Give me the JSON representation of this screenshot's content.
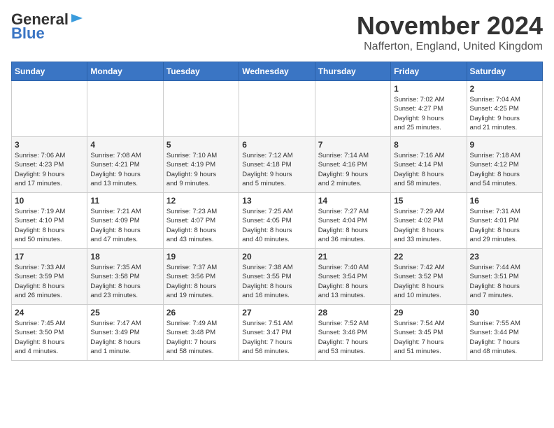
{
  "logo": {
    "line1": "General",
    "line2": "Blue"
  },
  "header": {
    "month": "November 2024",
    "location": "Nafferton, England, United Kingdom"
  },
  "days_of_week": [
    "Sunday",
    "Monday",
    "Tuesday",
    "Wednesday",
    "Thursday",
    "Friday",
    "Saturday"
  ],
  "weeks": [
    [
      {
        "day": "",
        "info": ""
      },
      {
        "day": "",
        "info": ""
      },
      {
        "day": "",
        "info": ""
      },
      {
        "day": "",
        "info": ""
      },
      {
        "day": "",
        "info": ""
      },
      {
        "day": "1",
        "info": "Sunrise: 7:02 AM\nSunset: 4:27 PM\nDaylight: 9 hours\nand 25 minutes."
      },
      {
        "day": "2",
        "info": "Sunrise: 7:04 AM\nSunset: 4:25 PM\nDaylight: 9 hours\nand 21 minutes."
      }
    ],
    [
      {
        "day": "3",
        "info": "Sunrise: 7:06 AM\nSunset: 4:23 PM\nDaylight: 9 hours\nand 17 minutes."
      },
      {
        "day": "4",
        "info": "Sunrise: 7:08 AM\nSunset: 4:21 PM\nDaylight: 9 hours\nand 13 minutes."
      },
      {
        "day": "5",
        "info": "Sunrise: 7:10 AM\nSunset: 4:19 PM\nDaylight: 9 hours\nand 9 minutes."
      },
      {
        "day": "6",
        "info": "Sunrise: 7:12 AM\nSunset: 4:18 PM\nDaylight: 9 hours\nand 5 minutes."
      },
      {
        "day": "7",
        "info": "Sunrise: 7:14 AM\nSunset: 4:16 PM\nDaylight: 9 hours\nand 2 minutes."
      },
      {
        "day": "8",
        "info": "Sunrise: 7:16 AM\nSunset: 4:14 PM\nDaylight: 8 hours\nand 58 minutes."
      },
      {
        "day": "9",
        "info": "Sunrise: 7:18 AM\nSunset: 4:12 PM\nDaylight: 8 hours\nand 54 minutes."
      }
    ],
    [
      {
        "day": "10",
        "info": "Sunrise: 7:19 AM\nSunset: 4:10 PM\nDaylight: 8 hours\nand 50 minutes."
      },
      {
        "day": "11",
        "info": "Sunrise: 7:21 AM\nSunset: 4:09 PM\nDaylight: 8 hours\nand 47 minutes."
      },
      {
        "day": "12",
        "info": "Sunrise: 7:23 AM\nSunset: 4:07 PM\nDaylight: 8 hours\nand 43 minutes."
      },
      {
        "day": "13",
        "info": "Sunrise: 7:25 AM\nSunset: 4:05 PM\nDaylight: 8 hours\nand 40 minutes."
      },
      {
        "day": "14",
        "info": "Sunrise: 7:27 AM\nSunset: 4:04 PM\nDaylight: 8 hours\nand 36 minutes."
      },
      {
        "day": "15",
        "info": "Sunrise: 7:29 AM\nSunset: 4:02 PM\nDaylight: 8 hours\nand 33 minutes."
      },
      {
        "day": "16",
        "info": "Sunrise: 7:31 AM\nSunset: 4:01 PM\nDaylight: 8 hours\nand 29 minutes."
      }
    ],
    [
      {
        "day": "17",
        "info": "Sunrise: 7:33 AM\nSunset: 3:59 PM\nDaylight: 8 hours\nand 26 minutes."
      },
      {
        "day": "18",
        "info": "Sunrise: 7:35 AM\nSunset: 3:58 PM\nDaylight: 8 hours\nand 23 minutes."
      },
      {
        "day": "19",
        "info": "Sunrise: 7:37 AM\nSunset: 3:56 PM\nDaylight: 8 hours\nand 19 minutes."
      },
      {
        "day": "20",
        "info": "Sunrise: 7:38 AM\nSunset: 3:55 PM\nDaylight: 8 hours\nand 16 minutes."
      },
      {
        "day": "21",
        "info": "Sunrise: 7:40 AM\nSunset: 3:54 PM\nDaylight: 8 hours\nand 13 minutes."
      },
      {
        "day": "22",
        "info": "Sunrise: 7:42 AM\nSunset: 3:52 PM\nDaylight: 8 hours\nand 10 minutes."
      },
      {
        "day": "23",
        "info": "Sunrise: 7:44 AM\nSunset: 3:51 PM\nDaylight: 8 hours\nand 7 minutes."
      }
    ],
    [
      {
        "day": "24",
        "info": "Sunrise: 7:45 AM\nSunset: 3:50 PM\nDaylight: 8 hours\nand 4 minutes."
      },
      {
        "day": "25",
        "info": "Sunrise: 7:47 AM\nSunset: 3:49 PM\nDaylight: 8 hours\nand 1 minute."
      },
      {
        "day": "26",
        "info": "Sunrise: 7:49 AM\nSunset: 3:48 PM\nDaylight: 7 hours\nand 58 minutes."
      },
      {
        "day": "27",
        "info": "Sunrise: 7:51 AM\nSunset: 3:47 PM\nDaylight: 7 hours\nand 56 minutes."
      },
      {
        "day": "28",
        "info": "Sunrise: 7:52 AM\nSunset: 3:46 PM\nDaylight: 7 hours\nand 53 minutes."
      },
      {
        "day": "29",
        "info": "Sunrise: 7:54 AM\nSunset: 3:45 PM\nDaylight: 7 hours\nand 51 minutes."
      },
      {
        "day": "30",
        "info": "Sunrise: 7:55 AM\nSunset: 3:44 PM\nDaylight: 7 hours\nand 48 minutes."
      }
    ]
  ]
}
